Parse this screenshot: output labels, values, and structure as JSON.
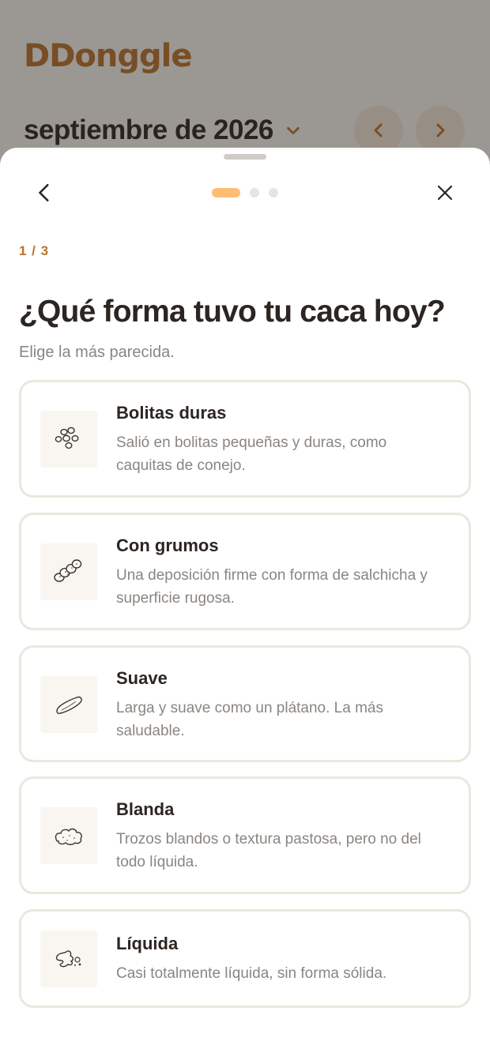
{
  "app": {
    "logo": "DDonggle",
    "month_label": "septiembre de 2026"
  },
  "sheet": {
    "step_indicator": "1 / 3",
    "progress": {
      "current": 1,
      "total": 3
    },
    "question": "¿Qué forma tuvo tu caca hoy?",
    "hint": "Elige la más parecida."
  },
  "options": [
    {
      "title": "Bolitas duras",
      "description": "Salió en bolitas pequeñas y duras, como caquitas de conejo.",
      "icon": "pellets-icon"
    },
    {
      "title": "Con grumos",
      "description": "Una deposición firme con forma de salchicha y superficie rugosa.",
      "icon": "lumpy-sausage-icon"
    },
    {
      "title": "Suave",
      "description": "Larga y suave como un plátano. La más saludable.",
      "icon": "smooth-sausage-icon"
    },
    {
      "title": "Blanda",
      "description": "Trozos blandos o textura pastosa, pero no del todo líquida.",
      "icon": "soft-blob-icon"
    },
    {
      "title": "Líquida",
      "description": "Casi totalmente líquida, sin forma sólida.",
      "icon": "liquid-splash-icon"
    }
  ],
  "colors": {
    "accent": "#b9742a",
    "progress_active": "#ffbd73",
    "text_primary": "#2c2521",
    "text_secondary": "#8b8580",
    "card_border": "#ece7de"
  }
}
